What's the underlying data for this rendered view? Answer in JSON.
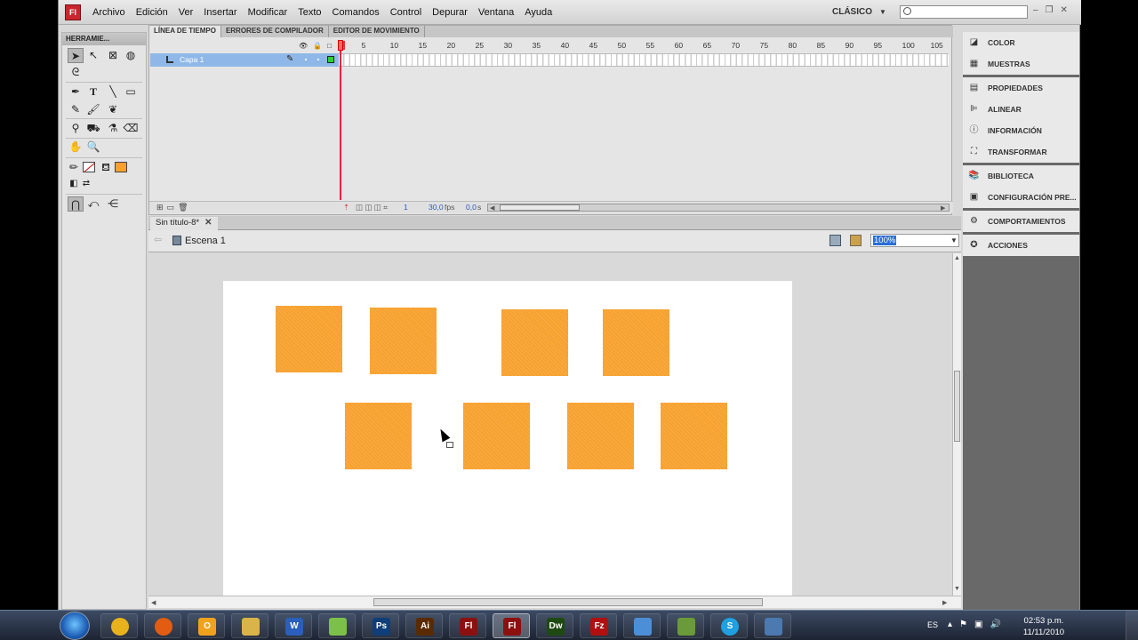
{
  "app": {
    "logo_text": "Fl",
    "menu": [
      "Archivo",
      "Edición",
      "Ver",
      "Insertar",
      "Modificar",
      "Texto",
      "Comandos",
      "Control",
      "Depurar",
      "Ventana",
      "Ayuda"
    ],
    "workspace": "CLÁSICO",
    "search_placeholder": ""
  },
  "tools": {
    "header": "HERRAMIE..."
  },
  "timeline": {
    "tabs": [
      "LÍNEA DE TIEMPO",
      "ERRORES DE COMPILADOR",
      "EDITOR DE MOVIMIENTO"
    ],
    "frame_ticks": [
      "1",
      "5",
      "10",
      "15",
      "20",
      "25",
      "30",
      "35",
      "40",
      "45",
      "50",
      "55",
      "60",
      "65",
      "70",
      "75",
      "80",
      "85",
      "90",
      "95",
      "100",
      "105"
    ],
    "layer_name": "Capa 1",
    "current_frame": "1",
    "fps": "30,0",
    "fps_unit": "fps",
    "time": "0,0",
    "time_unit": "s"
  },
  "document": {
    "tab_title": "Sin título-8*",
    "tab_close": "✕",
    "scene": "Escena 1",
    "zoom": "100%"
  },
  "stage": {
    "fill_color": "#f7a12e",
    "squares_count": 8
  },
  "panels": {
    "group1": [
      "COLOR",
      "MUESTRAS"
    ],
    "group2": [
      "PROPIEDADES",
      "ALINEAR",
      "INFORMACIÓN",
      "TRANSFORMAR"
    ],
    "group3": [
      "BIBLIOTECA",
      "CONFIGURACIÓN PRE..."
    ],
    "group4": [
      "COMPORTAMIENTOS"
    ],
    "group5": [
      "ACCIONES"
    ]
  },
  "taskbar": {
    "apps": [
      "chrome-icon",
      "firefox-icon",
      "outlook-icon",
      "explorer-icon",
      "word-icon",
      "utility-icon",
      "photoshop-icon",
      "illustrator-icon",
      "flash-icon",
      "flash-icon-active",
      "dreamweaver-icon",
      "filezilla-icon",
      "messenger-icon",
      "green-app-icon",
      "skype-icon",
      "network-icon"
    ],
    "app_labels": [
      "",
      "",
      "O",
      "",
      "W",
      "",
      "Ps",
      "Ai",
      "Fl",
      "Fl",
      "Dw",
      "Fz",
      "",
      "",
      "S",
      ""
    ],
    "language": "ES",
    "time": "02:53 p.m.",
    "date": "11/11/2010"
  }
}
